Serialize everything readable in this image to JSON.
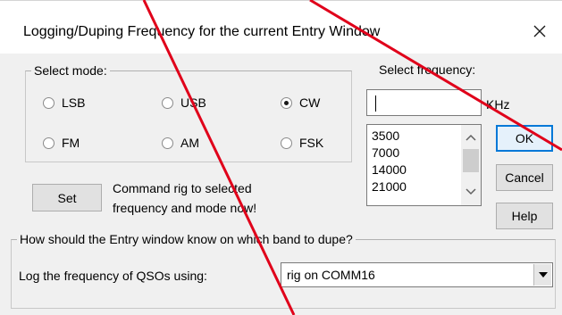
{
  "window": {
    "title": "Logging/Duping Frequency for the current Entry Window",
    "close_glyph": "✕"
  },
  "mode_group": {
    "legend": "Select mode:",
    "options": [
      {
        "label": "LSB",
        "selected": false
      },
      {
        "label": "USB",
        "selected": false
      },
      {
        "label": "CW",
        "selected": true
      },
      {
        "label": "FM",
        "selected": false
      },
      {
        "label": "AM",
        "selected": false
      },
      {
        "label": "FSK",
        "selected": false
      }
    ]
  },
  "frequency": {
    "heading": "Select frequency:",
    "input_value": "",
    "unit": "KHz",
    "list": [
      "3500",
      "7000",
      "14000",
      "21000"
    ]
  },
  "buttons": {
    "ok": "OK",
    "cancel": "Cancel",
    "help": "Help",
    "set": "Set"
  },
  "command_text": {
    "line1": "Command rig to selected",
    "line2": "frequency and mode now!"
  },
  "band_group": {
    "legend": "How should the Entry window know on which band to dupe?",
    "prompt": "Log the frequency of QSOs using:",
    "selected": "rig on COMM16"
  },
  "colors": {
    "annotation_lines": "#e0001a",
    "default_button_border": "#0078d7"
  }
}
